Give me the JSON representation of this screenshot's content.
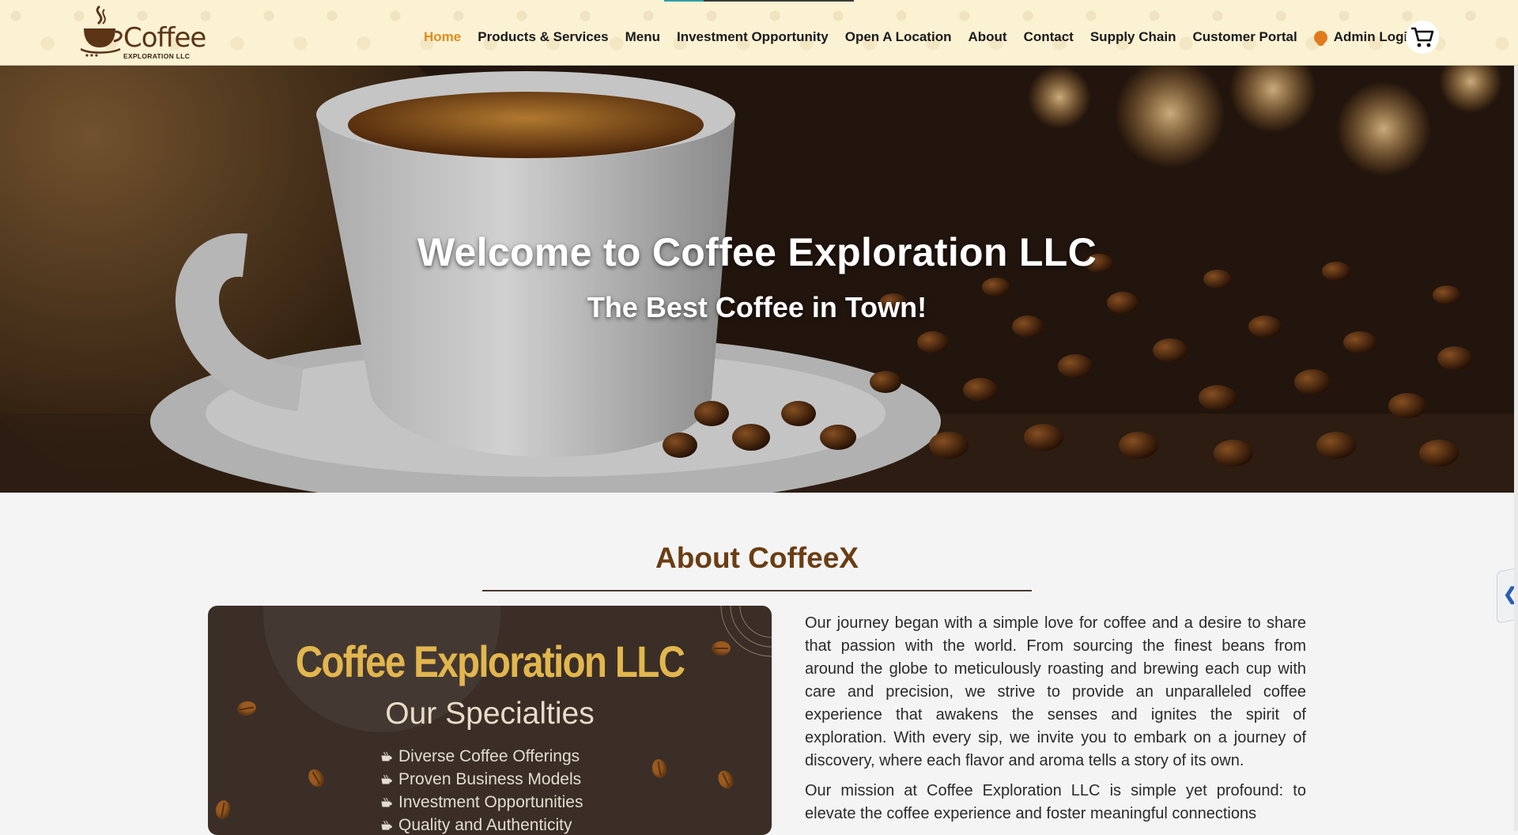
{
  "brand": {
    "logo_word": "Coffee",
    "logo_sub": "EXPLORATION LLC"
  },
  "nav": {
    "items": [
      {
        "label": "Home",
        "active": true
      },
      {
        "label": "Products & Services",
        "active": false
      },
      {
        "label": "Menu",
        "active": false
      },
      {
        "label": "Investment Opportunity",
        "active": false
      },
      {
        "label": "Open A Location",
        "active": false
      },
      {
        "label": "About",
        "active": false
      },
      {
        "label": "Contact",
        "active": false
      },
      {
        "label": "Supply Chain",
        "active": false
      },
      {
        "label": "Customer Portal",
        "active": false
      }
    ],
    "admin_label": "Admin Login",
    "cart_icon": "shopping-cart-icon"
  },
  "hero": {
    "title": "Welcome to Coffee Exploration LLC",
    "subtitle": "The Best Coffee in Town!"
  },
  "about": {
    "heading": "About CoffeeX",
    "promo": {
      "title": "Coffee Exploration LLC",
      "subtitle": "Our Specialties",
      "items": [
        "Diverse Coffee Offerings",
        "Proven Business Models",
        "Investment Opportunities",
        "Quality and Authenticity"
      ]
    },
    "paragraphs": [
      "Our journey began with a simple love for coffee and a desire to share that passion with the world. From sourcing the finest beans from around the globe to meticulously roasting and brewing each cup with care and precision, we strive to provide an unparalleled coffee experience that awakens the senses and ignites the spirit of exploration. With every sip, we invite you to embark on a journey of discovery, where each flavor and aroma tells a story of its own.",
      "Our mission at Coffee Exploration LLC is simple yet profound: to elevate the coffee experience and foster meaningful connections"
    ]
  },
  "side_tab": {
    "label": "❮"
  },
  "colors": {
    "header_bg": "#fbf1d3",
    "nav_active": "#e08c1e",
    "brand_brown": "#6a3d12",
    "promo_gold": "#e2b64e",
    "promo_bg": "#3a2e27",
    "page_bg": "#f4f4f5"
  }
}
